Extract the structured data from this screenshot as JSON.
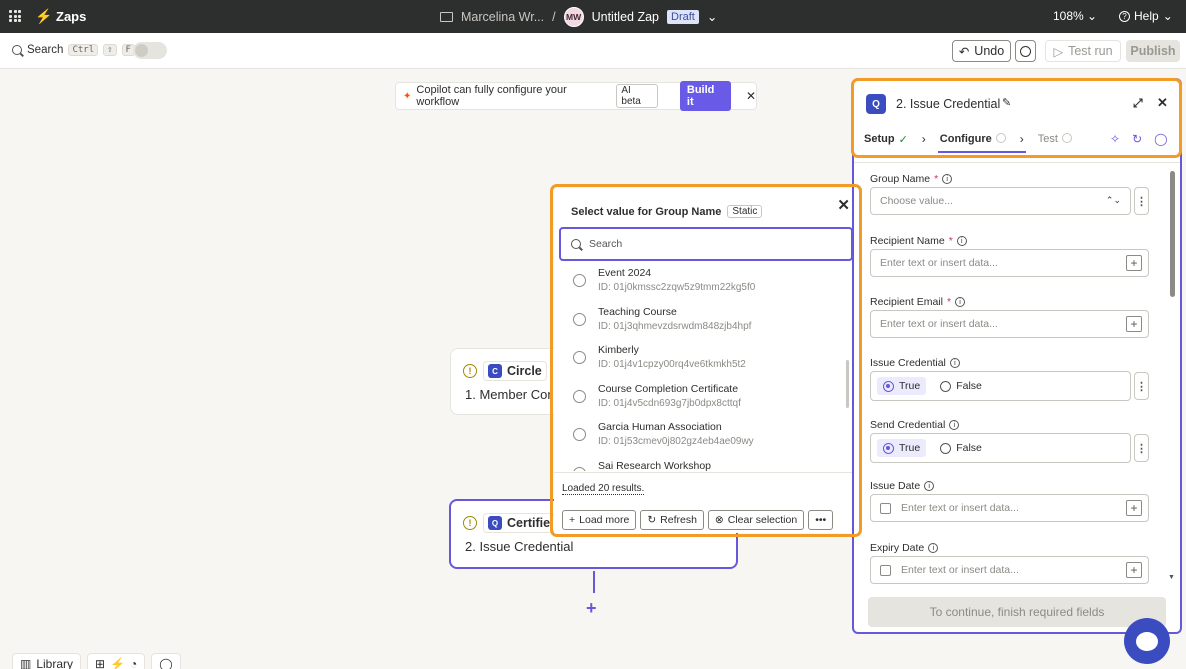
{
  "topbar": {
    "brand": "Zaps",
    "folder": "Marcelina Wr...",
    "separator": "/",
    "avatar": "MW",
    "zap_name": "Untitled Zap",
    "status": "Draft",
    "zoom": "108%",
    "help": "Help"
  },
  "toolbar": {
    "search_label": "Search",
    "shortcut_keys": [
      "Ctrl",
      "⇧",
      "F"
    ],
    "undo": "Undo",
    "test_run": "Test run",
    "publish": "Publish"
  },
  "copilot": {
    "message": "Copilot can fully configure your workflow",
    "badge": "AI beta",
    "button": "Build it"
  },
  "nodes": [
    {
      "app": "Circle",
      "title": "1. Member Cor"
    },
    {
      "app": "Certifie",
      "title": "2. Issue Credential"
    }
  ],
  "popup": {
    "title": "Select value for Group Name",
    "badge": "Static",
    "search_placeholder": "Search",
    "items": [
      {
        "name": "Event 2024",
        "id": "ID: 01j0kmssc2zqw5z9tmm22kg5f0"
      },
      {
        "name": "Teaching Course",
        "id": "ID: 01j3qhmevzdsrwdm848zjb4hpf"
      },
      {
        "name": "Kimberly",
        "id": "ID: 01j4v1cpzy00rq4ve6tkmkh5t2"
      },
      {
        "name": "Course Completion Certificate",
        "id": "ID: 01j4v5cdn693g7jb0dpx8cttqf"
      },
      {
        "name": "Garcia Human Association",
        "id": "ID: 01j53cmev0j802gz4eb4ae09wy"
      },
      {
        "name": "Sai Research Workshop",
        "id": ""
      }
    ],
    "loaded": "Loaded 20 results.",
    "buttons": {
      "load_more": "Load more",
      "refresh": "Refresh",
      "clear": "Clear selection",
      "more": "•••"
    }
  },
  "panel": {
    "title": "2. Issue Credential",
    "steps": {
      "setup": "Setup",
      "configure": "Configure",
      "test": "Test"
    },
    "fields": {
      "group_name": {
        "label": "Group Name",
        "placeholder": "Choose value..."
      },
      "recipient_name": {
        "label": "Recipient Name",
        "placeholder": "Enter text or insert data..."
      },
      "recipient_email": {
        "label": "Recipient Email",
        "placeholder": "Enter text or insert data..."
      },
      "issue_credential": {
        "label": "Issue Credential",
        "true": "True",
        "false": "False"
      },
      "send_credential": {
        "label": "Send Credential",
        "true": "True",
        "false": "False"
      },
      "issue_date": {
        "label": "Issue Date",
        "placeholder": "Enter text or insert data..."
      },
      "expiry_date": {
        "label": "Expiry Date",
        "placeholder": "Enter text or insert data..."
      }
    },
    "continue": "To continue, finish required fields"
  },
  "bottombar": {
    "library": "Library"
  },
  "colors": {
    "accent": "#6558db",
    "highlight": "#f29b26",
    "brand": "#ff4f00"
  }
}
